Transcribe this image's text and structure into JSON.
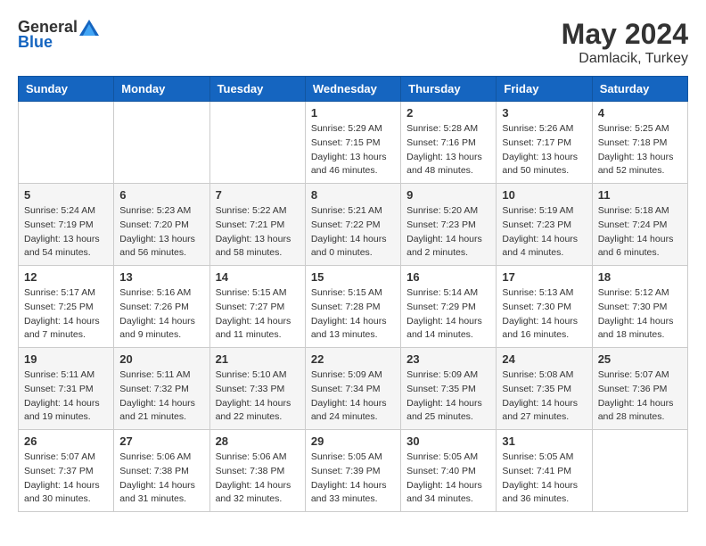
{
  "logo": {
    "text_general": "General",
    "text_blue": "Blue"
  },
  "title": {
    "month_year": "May 2024",
    "location": "Damlacik, Turkey"
  },
  "headers": [
    "Sunday",
    "Monday",
    "Tuesday",
    "Wednesday",
    "Thursday",
    "Friday",
    "Saturday"
  ],
  "weeks": [
    [
      {
        "day": "",
        "sunrise": "",
        "sunset": "",
        "daylight": ""
      },
      {
        "day": "",
        "sunrise": "",
        "sunset": "",
        "daylight": ""
      },
      {
        "day": "",
        "sunrise": "",
        "sunset": "",
        "daylight": ""
      },
      {
        "day": "1",
        "sunrise": "Sunrise: 5:29 AM",
        "sunset": "Sunset: 7:15 PM",
        "daylight": "Daylight: 13 hours and 46 minutes."
      },
      {
        "day": "2",
        "sunrise": "Sunrise: 5:28 AM",
        "sunset": "Sunset: 7:16 PM",
        "daylight": "Daylight: 13 hours and 48 minutes."
      },
      {
        "day": "3",
        "sunrise": "Sunrise: 5:26 AM",
        "sunset": "Sunset: 7:17 PM",
        "daylight": "Daylight: 13 hours and 50 minutes."
      },
      {
        "day": "4",
        "sunrise": "Sunrise: 5:25 AM",
        "sunset": "Sunset: 7:18 PM",
        "daylight": "Daylight: 13 hours and 52 minutes."
      }
    ],
    [
      {
        "day": "5",
        "sunrise": "Sunrise: 5:24 AM",
        "sunset": "Sunset: 7:19 PM",
        "daylight": "Daylight: 13 hours and 54 minutes."
      },
      {
        "day": "6",
        "sunrise": "Sunrise: 5:23 AM",
        "sunset": "Sunset: 7:20 PM",
        "daylight": "Daylight: 13 hours and 56 minutes."
      },
      {
        "day": "7",
        "sunrise": "Sunrise: 5:22 AM",
        "sunset": "Sunset: 7:21 PM",
        "daylight": "Daylight: 13 hours and 58 minutes."
      },
      {
        "day": "8",
        "sunrise": "Sunrise: 5:21 AM",
        "sunset": "Sunset: 7:22 PM",
        "daylight": "Daylight: 14 hours and 0 minutes."
      },
      {
        "day": "9",
        "sunrise": "Sunrise: 5:20 AM",
        "sunset": "Sunset: 7:23 PM",
        "daylight": "Daylight: 14 hours and 2 minutes."
      },
      {
        "day": "10",
        "sunrise": "Sunrise: 5:19 AM",
        "sunset": "Sunset: 7:23 PM",
        "daylight": "Daylight: 14 hours and 4 minutes."
      },
      {
        "day": "11",
        "sunrise": "Sunrise: 5:18 AM",
        "sunset": "Sunset: 7:24 PM",
        "daylight": "Daylight: 14 hours and 6 minutes."
      }
    ],
    [
      {
        "day": "12",
        "sunrise": "Sunrise: 5:17 AM",
        "sunset": "Sunset: 7:25 PM",
        "daylight": "Daylight: 14 hours and 7 minutes."
      },
      {
        "day": "13",
        "sunrise": "Sunrise: 5:16 AM",
        "sunset": "Sunset: 7:26 PM",
        "daylight": "Daylight: 14 hours and 9 minutes."
      },
      {
        "day": "14",
        "sunrise": "Sunrise: 5:15 AM",
        "sunset": "Sunset: 7:27 PM",
        "daylight": "Daylight: 14 hours and 11 minutes."
      },
      {
        "day": "15",
        "sunrise": "Sunrise: 5:15 AM",
        "sunset": "Sunset: 7:28 PM",
        "daylight": "Daylight: 14 hours and 13 minutes."
      },
      {
        "day": "16",
        "sunrise": "Sunrise: 5:14 AM",
        "sunset": "Sunset: 7:29 PM",
        "daylight": "Daylight: 14 hours and 14 minutes."
      },
      {
        "day": "17",
        "sunrise": "Sunrise: 5:13 AM",
        "sunset": "Sunset: 7:30 PM",
        "daylight": "Daylight: 14 hours and 16 minutes."
      },
      {
        "day": "18",
        "sunrise": "Sunrise: 5:12 AM",
        "sunset": "Sunset: 7:30 PM",
        "daylight": "Daylight: 14 hours and 18 minutes."
      }
    ],
    [
      {
        "day": "19",
        "sunrise": "Sunrise: 5:11 AM",
        "sunset": "Sunset: 7:31 PM",
        "daylight": "Daylight: 14 hours and 19 minutes."
      },
      {
        "day": "20",
        "sunrise": "Sunrise: 5:11 AM",
        "sunset": "Sunset: 7:32 PM",
        "daylight": "Daylight: 14 hours and 21 minutes."
      },
      {
        "day": "21",
        "sunrise": "Sunrise: 5:10 AM",
        "sunset": "Sunset: 7:33 PM",
        "daylight": "Daylight: 14 hours and 22 minutes."
      },
      {
        "day": "22",
        "sunrise": "Sunrise: 5:09 AM",
        "sunset": "Sunset: 7:34 PM",
        "daylight": "Daylight: 14 hours and 24 minutes."
      },
      {
        "day": "23",
        "sunrise": "Sunrise: 5:09 AM",
        "sunset": "Sunset: 7:35 PM",
        "daylight": "Daylight: 14 hours and 25 minutes."
      },
      {
        "day": "24",
        "sunrise": "Sunrise: 5:08 AM",
        "sunset": "Sunset: 7:35 PM",
        "daylight": "Daylight: 14 hours and 27 minutes."
      },
      {
        "day": "25",
        "sunrise": "Sunrise: 5:07 AM",
        "sunset": "Sunset: 7:36 PM",
        "daylight": "Daylight: 14 hours and 28 minutes."
      }
    ],
    [
      {
        "day": "26",
        "sunrise": "Sunrise: 5:07 AM",
        "sunset": "Sunset: 7:37 PM",
        "daylight": "Daylight: 14 hours and 30 minutes."
      },
      {
        "day": "27",
        "sunrise": "Sunrise: 5:06 AM",
        "sunset": "Sunset: 7:38 PM",
        "daylight": "Daylight: 14 hours and 31 minutes."
      },
      {
        "day": "28",
        "sunrise": "Sunrise: 5:06 AM",
        "sunset": "Sunset: 7:38 PM",
        "daylight": "Daylight: 14 hours and 32 minutes."
      },
      {
        "day": "29",
        "sunrise": "Sunrise: 5:05 AM",
        "sunset": "Sunset: 7:39 PM",
        "daylight": "Daylight: 14 hours and 33 minutes."
      },
      {
        "day": "30",
        "sunrise": "Sunrise: 5:05 AM",
        "sunset": "Sunset: 7:40 PM",
        "daylight": "Daylight: 14 hours and 34 minutes."
      },
      {
        "day": "31",
        "sunrise": "Sunrise: 5:05 AM",
        "sunset": "Sunset: 7:41 PM",
        "daylight": "Daylight: 14 hours and 36 minutes."
      },
      {
        "day": "",
        "sunrise": "",
        "sunset": "",
        "daylight": ""
      }
    ]
  ]
}
